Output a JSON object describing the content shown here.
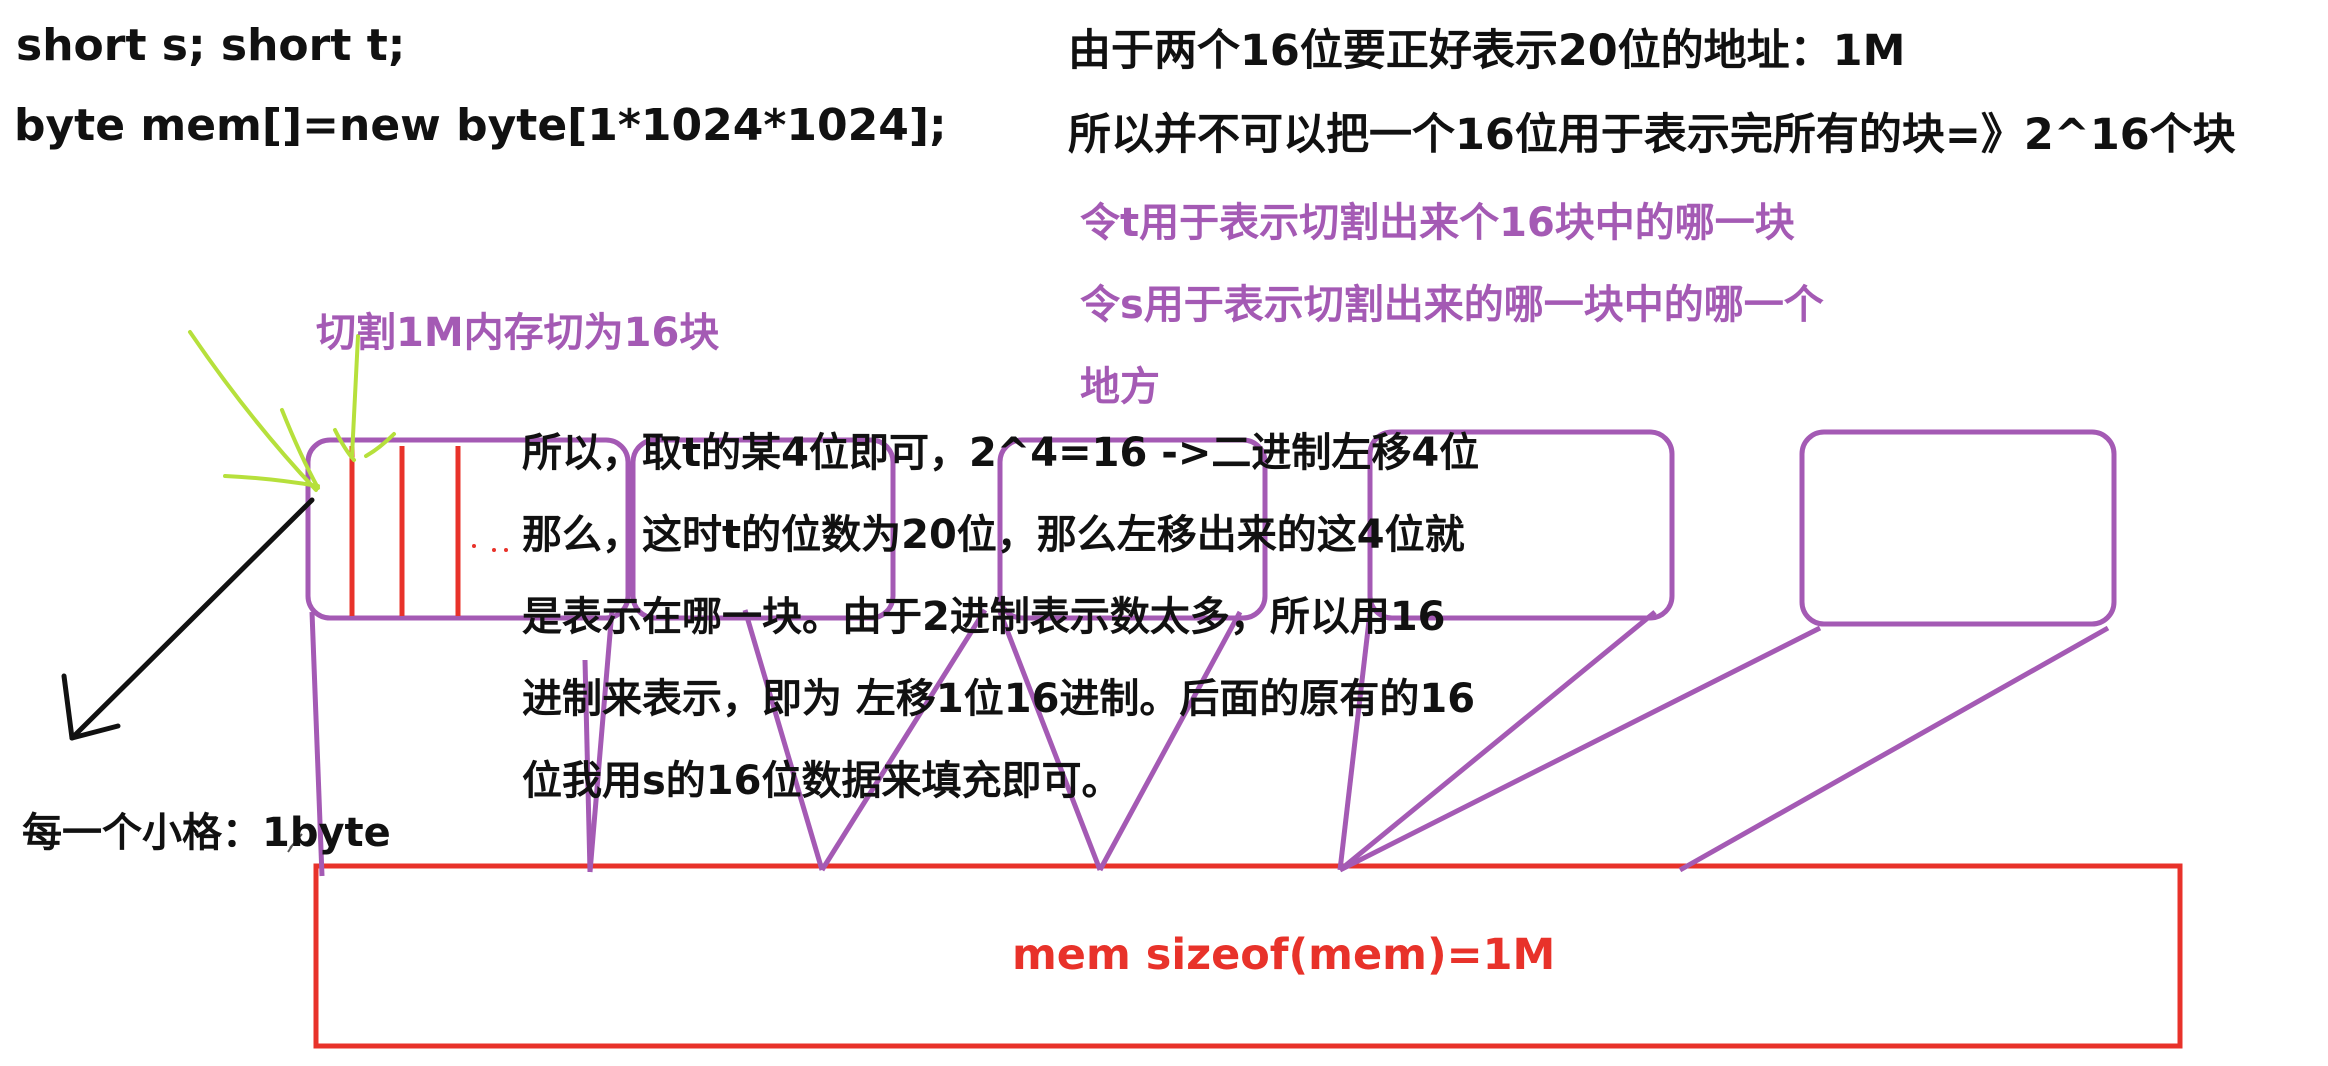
{
  "code": {
    "line1": "short s; short t;",
    "line2": "byte mem[]=new byte[1*1024*1024];"
  },
  "notes": {
    "line1": "由于两个16位要正好表示20位的地址：1M",
    "line2": "所以并不可以把一个16位用于表示完所有的块=》2^16个块",
    "purple1": "令t用于表示切割出来个16块中的哪一块",
    "purple2": "令s用于表示切割出来的哪一块中的哪一个",
    "purple3": "地方"
  },
  "split_label": "切割1M内存切为16块",
  "cell_label": "每一个小格：1byte",
  "explanation": [
    "所以，取t的某4位即可，2^4=16 ->二进制左移4位",
    "那么，这时t的位数为20位，那么左移出来的这4位就",
    "是表示在哪一块。由于2进制表示数太多，所以用16",
    "进制来表示，即为 左移1位16进制。后面的原有的16",
    "位我用s的16位数据来填充即可。"
  ],
  "memory_label": "mem sizeof(mem)=1M",
  "colors": {
    "text": "#111111",
    "purple": "#a45ab4",
    "red": "#e8322a",
    "green": "#b6e03c",
    "arrow": "#111111"
  }
}
